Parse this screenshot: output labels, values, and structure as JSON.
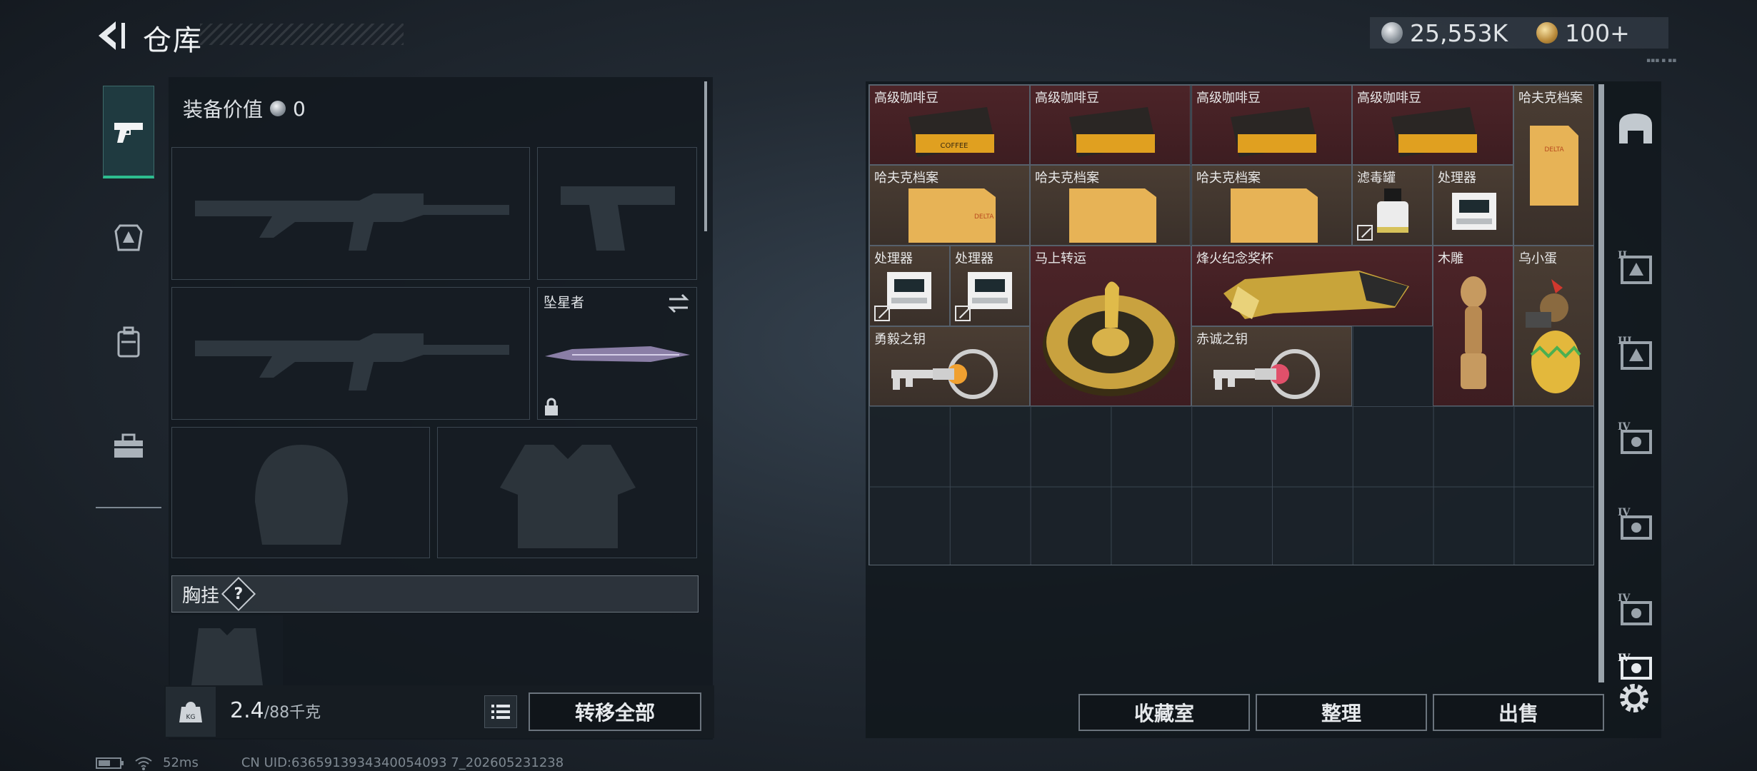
{
  "header": {
    "title": "仓库",
    "currency": [
      {
        "icon": "silver-coin-icon",
        "amount": "25,553K",
        "color": "#c8ced4"
      },
      {
        "icon": "gold-coin-icon",
        "amount": "100+",
        "color": "#d9b25a"
      }
    ]
  },
  "left_nav": {
    "items": [
      {
        "icon": "pistol-icon",
        "active": true
      },
      {
        "icon": "armor-icon",
        "active": false
      },
      {
        "icon": "backpack-icon",
        "active": false
      },
      {
        "icon": "toolbox-icon",
        "active": false
      }
    ]
  },
  "equipment": {
    "value_label": "装备价值",
    "value": "0",
    "melee_name": "坠星者",
    "chest_rig_label": "胸挂",
    "chest_rig_help": "?"
  },
  "weight": {
    "current": "2.4",
    "capacity": "/88千克"
  },
  "buttons": {
    "transfer_all": "转移全部",
    "collection_room": "收藏室",
    "organize": "整理",
    "sell": "出售"
  },
  "stash": {
    "items": [
      {
        "id": "coffee-1",
        "name": "高级咖啡豆",
        "rarity": "red",
        "icon": "coffee-beans-icon",
        "transferable": true
      },
      {
        "id": "coffee-2",
        "name": "高级咖啡豆",
        "rarity": "red",
        "icon": "coffee-beans-icon",
        "transferable": true
      },
      {
        "id": "coffee-3",
        "name": "高级咖啡豆",
        "rarity": "red",
        "icon": "coffee-beans-icon",
        "transferable": true
      },
      {
        "id": "coffee-4",
        "name": "高级咖啡豆",
        "rarity": "red",
        "icon": "coffee-beans-icon",
        "transferable": true
      },
      {
        "id": "hafk-1",
        "name": "哈夫克档案",
        "rarity": "brown",
        "icon": "folder-icon",
        "transferable": true
      },
      {
        "id": "hafk-2",
        "name": "哈夫克档案",
        "rarity": "brown",
        "icon": "folder-icon",
        "transferable": true
      },
      {
        "id": "hafk-3",
        "name": "哈夫克档案",
        "rarity": "brown",
        "icon": "folder-icon",
        "transferable": true
      },
      {
        "id": "hafk-4",
        "name": "哈夫克档案",
        "rarity": "brown",
        "icon": "folder-icon",
        "transferable": true
      },
      {
        "id": "filter",
        "name": "滤毒罐",
        "rarity": "brown",
        "icon": "filter-canister-icon",
        "transferable": false
      },
      {
        "id": "proc-1",
        "name": "处理器",
        "rarity": "brown",
        "icon": "processor-icon",
        "transferable": true
      },
      {
        "id": "proc-2",
        "name": "处理器",
        "rarity": "brown",
        "icon": "processor-icon",
        "transferable": false
      },
      {
        "id": "proc-3",
        "name": "处理器",
        "rarity": "brown",
        "icon": "processor-icon",
        "transferable": false
      },
      {
        "id": "wheel",
        "name": "马上转运",
        "rarity": "red",
        "icon": "golden-wheel-icon",
        "transferable": true
      },
      {
        "id": "trophy",
        "name": "烽火纪念奖杯",
        "rarity": "red",
        "icon": "trophy-icon",
        "transferable": true
      },
      {
        "id": "carving",
        "name": "木雕",
        "rarity": "red",
        "icon": "wood-carving-icon",
        "transferable": true
      },
      {
        "id": "egg",
        "name": "乌小蛋",
        "rarity": "brown",
        "icon": "egg-figure-icon",
        "transferable": true
      },
      {
        "id": "key-1",
        "name": "勇毅之钥",
        "rarity": "brown",
        "icon": "key-icon",
        "transferable": true
      },
      {
        "id": "key-2",
        "name": "赤诚之钥",
        "rarity": "brown",
        "icon": "key-icon",
        "transferable": true
      }
    ]
  },
  "right_nav": {
    "tabs": [
      {
        "icon": "main-stash-icon",
        "roman": ""
      },
      {
        "icon": "stash-tab-icon",
        "roman": "II"
      },
      {
        "icon": "stash-tab-icon",
        "roman": "III"
      },
      {
        "icon": "stash-tab-icon",
        "roman": "IV"
      },
      {
        "icon": "stash-tab-icon",
        "roman": "IV"
      },
      {
        "icon": "stash-tab-icon",
        "roman": "IV"
      },
      {
        "icon": "stash-tab-icon",
        "roman": "IV"
      }
    ]
  },
  "status_bar": {
    "ping": "52ms",
    "uid": "CN UID:6365913934340054093 7_202605231238"
  }
}
